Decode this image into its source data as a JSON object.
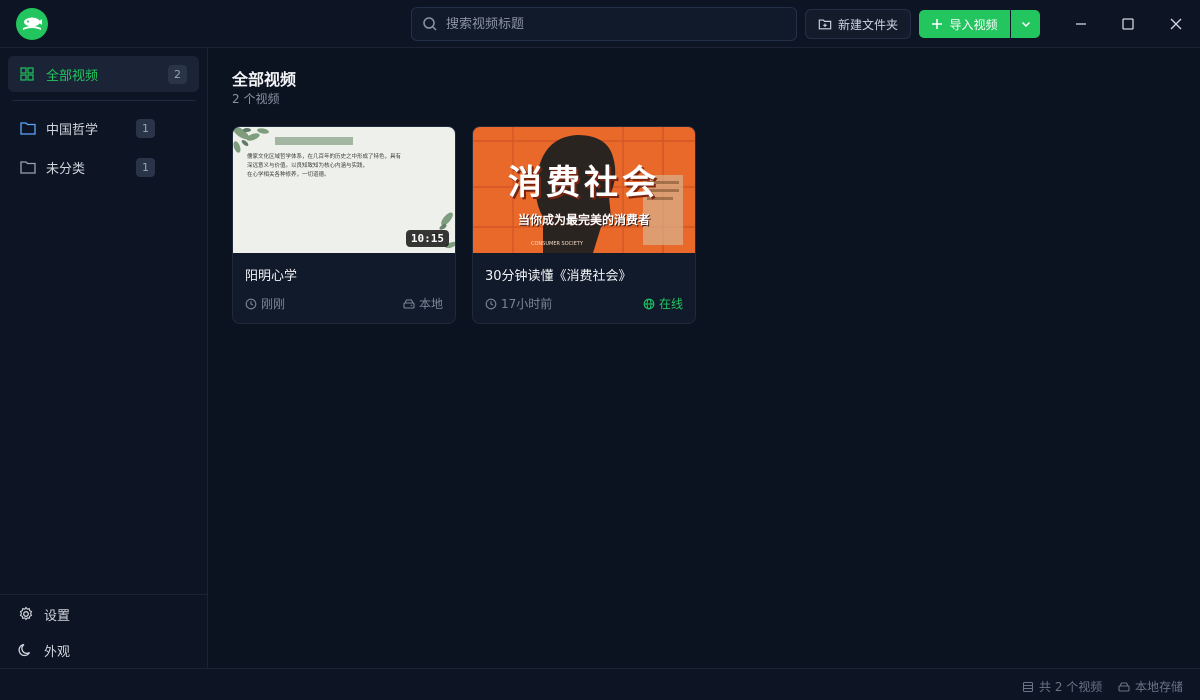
{
  "app": {
    "logo_icon": "fish-book-logo"
  },
  "search": {
    "placeholder": "搜索视频标题",
    "value": ""
  },
  "toolbar": {
    "new_folder_label": "新建文件夹",
    "import_label": "导入视频"
  },
  "sidebar": {
    "all": {
      "label": "全部视频",
      "count": "2"
    },
    "folders": [
      {
        "label": "中国哲学",
        "count": "1"
      },
      {
        "label": "未分类",
        "count": "1"
      }
    ],
    "bottom": [
      {
        "label": "设置",
        "icon": "gear-icon"
      },
      {
        "label": "外观",
        "icon": "moon-icon"
      }
    ]
  },
  "main": {
    "title": "全部视频",
    "subtitle": "2 个视频",
    "videos": [
      {
        "title": "阳明心学",
        "duration": "10:15",
        "time": "刚刚",
        "source": "本地",
        "thumb_lines": [
          "儒家文化区域哲学体系，在几百年的历史之中形成了特色，具有",
          "深远意义与价值。以良知致知为核心内涵与实践，",
          "在心学相关各种修养，一切道德。"
        ]
      },
      {
        "title": "30分钟读懂《消费社会》",
        "time": "17小时前",
        "source": "在线",
        "thumb_title": "消费社会",
        "thumb_subtitle": "当你成为最完美的消费者",
        "thumb_caption": "CONSUMER SOCIETY"
      }
    ]
  },
  "status": {
    "total": "共 2 个视频",
    "storage": "本地存储"
  },
  "colors": {
    "accent": "#22c55e",
    "background": "#0b1220",
    "orange": "#e8692a"
  }
}
